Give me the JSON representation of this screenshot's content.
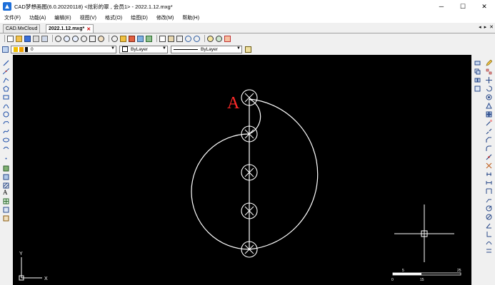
{
  "window": {
    "title": "CAD梦想画图(6.0.20220118) <炫彩的翠 , 会员1> - 2022.1.12.mxg*",
    "minimize": "─",
    "maximize": "☐",
    "close": "✕"
  },
  "menu": [
    "文件(F)",
    "功能(A)",
    "编辑(E)",
    "视图(V)",
    "格式(O)",
    "绘图(D)",
    "修改(M)",
    "帮助(H)"
  ],
  "tabs": [
    {
      "label": "CAD.MxCloud"
    },
    {
      "label": "2022.1.12.mxg*",
      "active": true
    }
  ],
  "tab_nav": {
    "left": "◂",
    "right": "▸",
    "close": "✕"
  },
  "layer_bar": {
    "layer_value": "0",
    "color_value": "ByLayer",
    "linetype_value": "ByLayer"
  },
  "drawing": {
    "label_a": "A",
    "ucs_x": "X",
    "ucs_y": "Y",
    "scale_ticks": [
      "0",
      "5",
      "15",
      "25"
    ]
  },
  "colors": {
    "canvas": "#000000",
    "geometry": "#ffffff",
    "label": "#ff2a2a",
    "accent": "#1e6fd9"
  }
}
